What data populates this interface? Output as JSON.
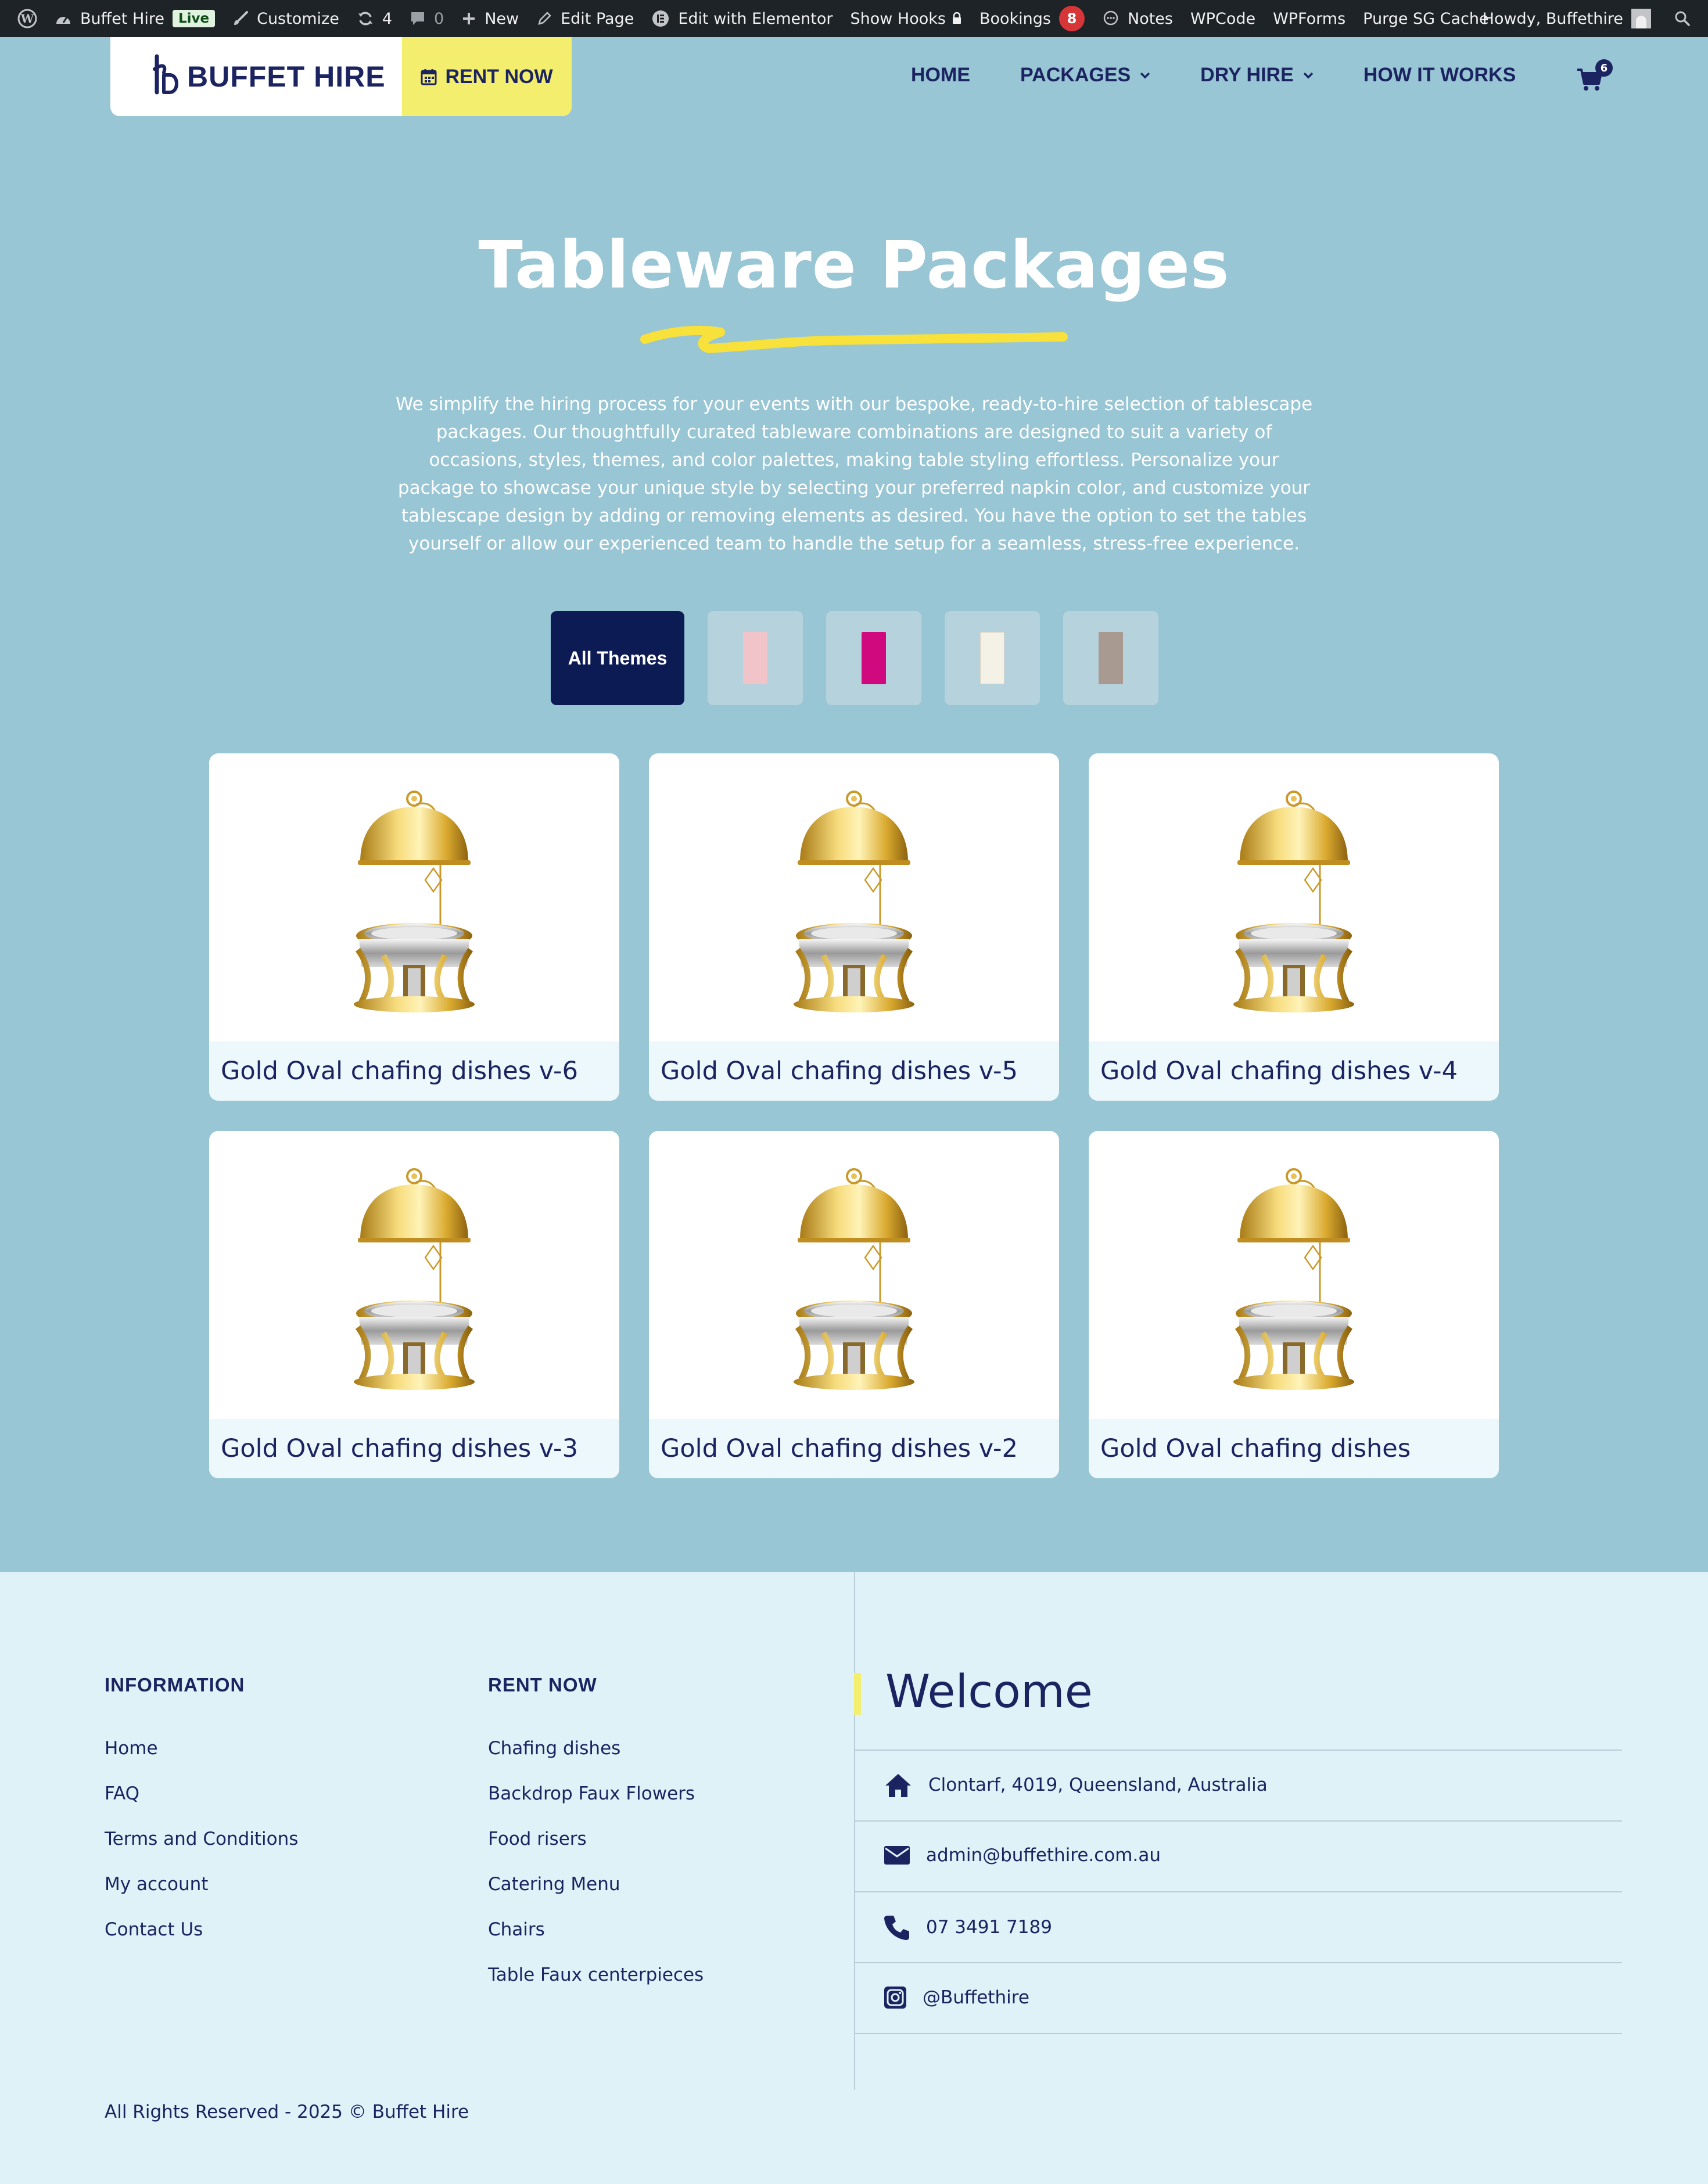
{
  "admin_bar": {
    "site_name": "Buffet Hire",
    "live_badge": "Live",
    "customize": "Customize",
    "updates_count": "4",
    "comments_count": "0",
    "new": "New",
    "edit_page": "Edit Page",
    "edit_elementor": "Edit with Elementor",
    "show_hooks": "Show Hooks",
    "bookings": "Bookings",
    "bookings_count": "8",
    "notes": "Notes",
    "wpcode": "WPCode",
    "wpforms": "WPForms",
    "purge_cache": "Purge SG Cache",
    "howdy": "Howdy, Buffethire"
  },
  "header": {
    "logo_text": "BUFFET HIRE",
    "rent_now": "RENT NOW",
    "nav": [
      "HOME",
      "PACKAGES",
      "DRY HIRE",
      "HOW IT WORKS"
    ],
    "cart_count": "6"
  },
  "hero": {
    "title": "Tableware Packages",
    "intro": "We simplify the hiring process for your events with our bespoke, ready-to-hire selection of tablescape packages. Our thoughtfully curated tableware combinations are designed to suit a variety of occasions, styles, themes, and color palettes, making table styling effortless. Personalize your package to showcase your unique style by selecting your preferred napkin color, and customize your tablescape design by adding or removing elements as desired. You have the option to set the tables yourself or allow our experienced team to handle the setup for a seamless, stress-free experience."
  },
  "filters": {
    "all_label": "All Themes",
    "swatches": [
      "#f0c4c8",
      "#d0097e",
      "#f4f1e6",
      "#a89a90"
    ]
  },
  "products": [
    "Gold Oval chafing dishes v-6",
    "Gold Oval chafing dishes v-5",
    "Gold Oval chafing dishes v-4",
    "Gold Oval chafing dishes v-3",
    "Gold Oval chafing dishes v-2",
    "Gold Oval chafing dishes"
  ],
  "footer": {
    "information_title": "INFORMATION",
    "information_links": [
      "Home",
      "FAQ",
      "Terms and Conditions",
      "My account",
      "Contact Us"
    ],
    "rent_title": "RENT NOW",
    "rent_links": [
      "Chafing dishes",
      "Backdrop Faux Flowers",
      "Food risers",
      "Catering Menu",
      "Chairs",
      "Table Faux centerpieces"
    ],
    "welcome": "Welcome",
    "address": "Clontarf, 4019, Queensland, Australia",
    "email": "admin@buffethire.com.au",
    "phone": "07 3491 7189",
    "instagram": "@Buffethire",
    "copyright": "All Rights Reserved - 2025 © Buffet Hire"
  },
  "colors": {
    "page_bg": "#98c6d5",
    "navy": "#1b2361",
    "accent_yellow": "#f3ee6d",
    "footer_bg": "#dff2f7"
  }
}
